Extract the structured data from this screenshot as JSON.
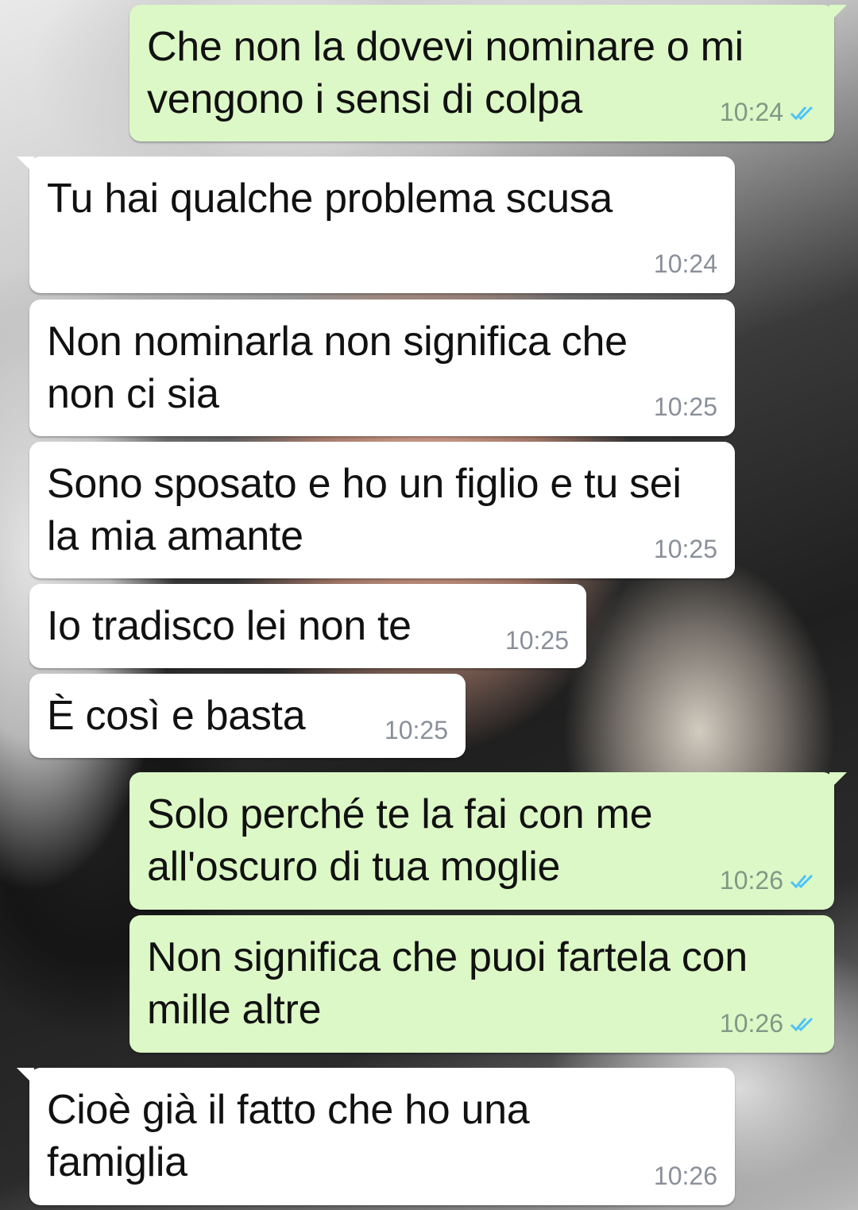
{
  "colors": {
    "incoming_bubble": "#ffffff",
    "outgoing_bubble": "#dcf8c6",
    "read_ticks": "#4fc3f7",
    "timestamp": "#8a9099"
  },
  "messages": [
    {
      "direction": "outgoing",
      "text": "Che non la dovevi nominare o mi\nvengono i sensi di colpa",
      "time": "10:24",
      "status": "read"
    },
    {
      "direction": "incoming",
      "text": "Tu hai qualche problema scusa",
      "time": "10:24"
    },
    {
      "direction": "incoming",
      "text": "Non nominarla non significa che\nnon ci sia",
      "time": "10:25"
    },
    {
      "direction": "incoming",
      "text": "Sono sposato e ho un figlio e tu sei\nla mia amante",
      "time": "10:25"
    },
    {
      "direction": "incoming",
      "text": "Io tradisco lei non te",
      "time": "10:25"
    },
    {
      "direction": "incoming",
      "text": "È così e basta",
      "time": "10:25"
    },
    {
      "direction": "outgoing",
      "text": "Solo perché te la fai con me\nall'oscuro di tua moglie",
      "time": "10:26",
      "status": "read"
    },
    {
      "direction": "outgoing",
      "text": "Non significa che puoi fartela con\nmille altre",
      "time": "10:26",
      "status": "read"
    },
    {
      "direction": "incoming",
      "text": "Cioè già il fatto che ho una\nfamiglia",
      "time": "10:26"
    }
  ]
}
